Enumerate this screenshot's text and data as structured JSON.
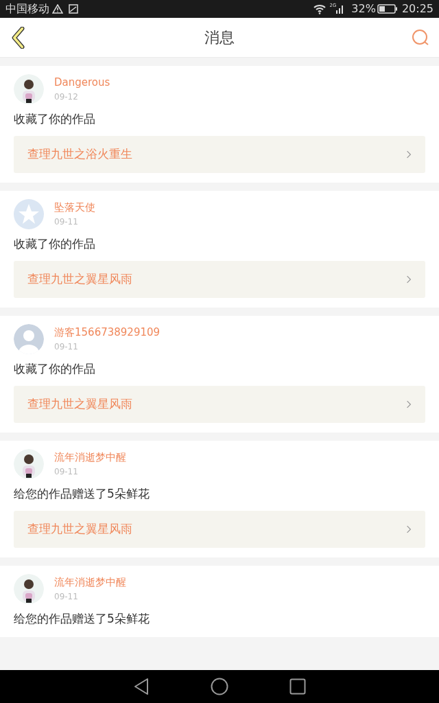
{
  "status_bar": {
    "carrier": "中国移动",
    "network": "2G",
    "battery": "32%",
    "time": "20:25"
  },
  "header": {
    "title": "消息"
  },
  "messages": [
    {
      "user": "Dangerous",
      "date": "09-12",
      "text": "收藏了你的作品",
      "link": "查理九世之浴火重生"
    },
    {
      "user": "坠落天使",
      "date": "09-11",
      "avatar": {
        "kind": "badge"
      },
      "text": "收藏了你的作品",
      "link": "查理九世之翼星风雨"
    },
    {
      "user": "游客1566738929109",
      "date": "09-11",
      "avatar": {
        "kind": "silhouette"
      },
      "text": "收藏了你的作品",
      "link": "查理九世之翼星风雨"
    },
    {
      "user": "流年消逝梦中醒",
      "date": "09-11",
      "text": "给您的作品赠送了5朵鲜花",
      "link": "查理九世之翼星风雨"
    },
    {
      "user": "流年消逝梦中醒",
      "date": "09-11",
      "text": "给您的作品赠送了5朵鲜花"
    }
  ]
}
